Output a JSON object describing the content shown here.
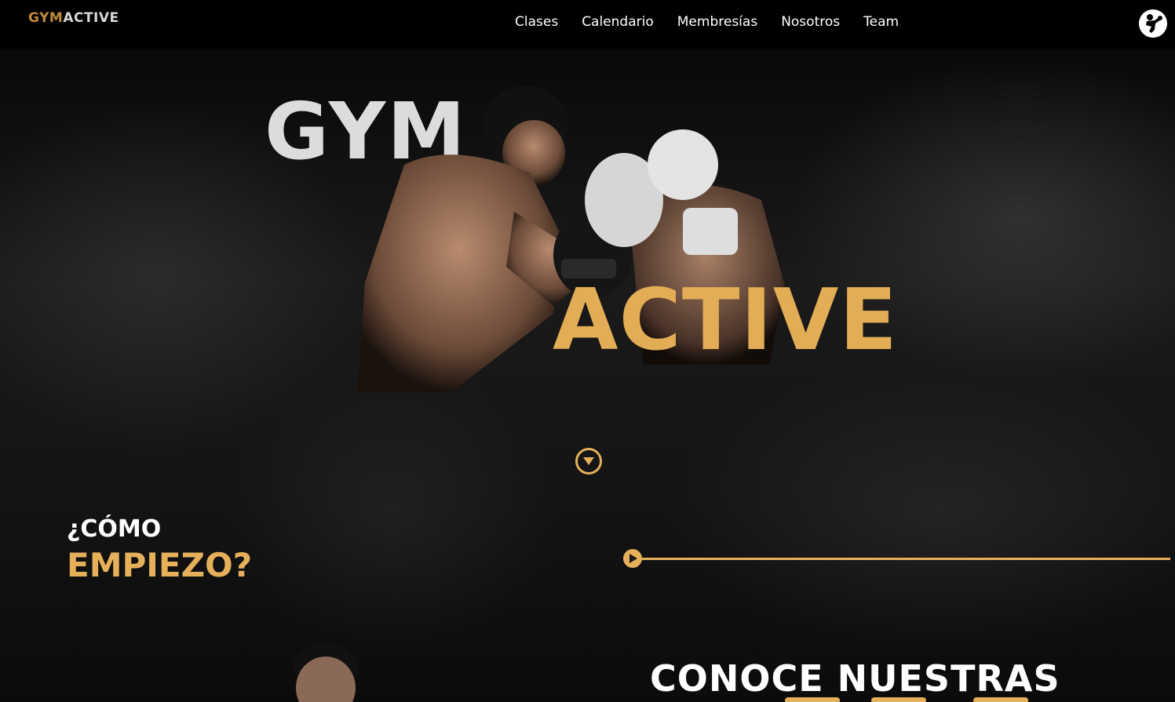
{
  "brand": {
    "logo_part1": "GYM",
    "logo_part2": "ACTIVE",
    "accent_color": "#e6b05a"
  },
  "nav": {
    "items": [
      {
        "label": "Clases"
      },
      {
        "label": "Calendario"
      },
      {
        "label": "Membresías"
      },
      {
        "label": "Nosotros"
      },
      {
        "label": "Team"
      }
    ]
  },
  "user": {
    "avatar_icon": "boxer-avatar-icon"
  },
  "hero": {
    "title_word1": "GYM",
    "title_word2": "ACTIVE",
    "scroll_icon": "chevron-down-circle-icon"
  },
  "how_to_start": {
    "question_line": "¿CÓMO",
    "answer_line": "EMPIEZO?",
    "timeline_icon": "play-icon"
  },
  "next_section": {
    "title": "CONOCE NUESTRAS"
  }
}
